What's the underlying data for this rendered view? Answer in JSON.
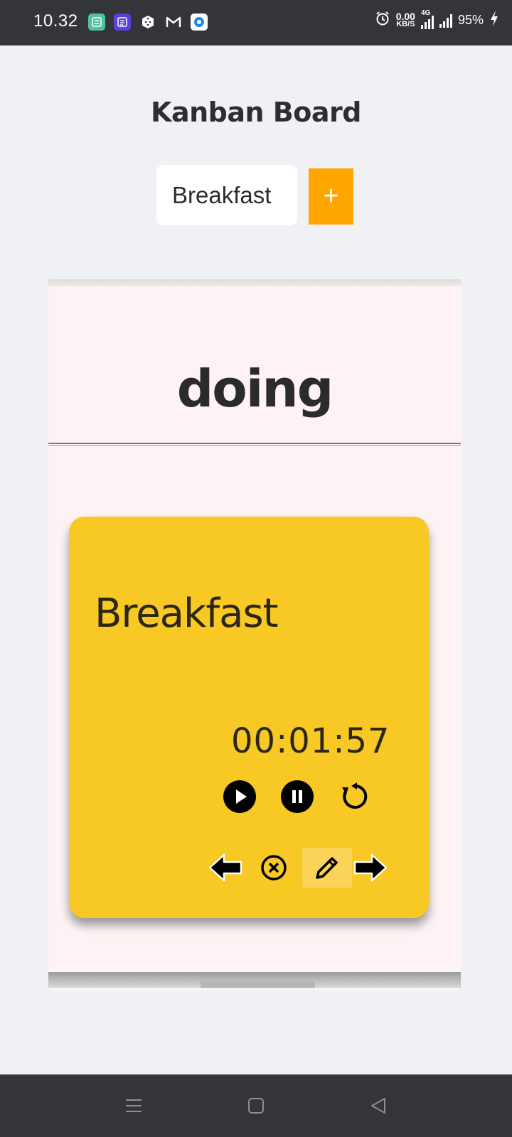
{
  "status_bar": {
    "time": "10.32",
    "net_speed_value": "0.00",
    "net_speed_unit": "KB/S",
    "network_type": "4G",
    "battery": "95%",
    "app_icons": [
      "calculator-app-icon",
      "notes-app-icon",
      "dice-app-icon",
      "gmail-icon",
      "browser-app-icon"
    ]
  },
  "header": {
    "title": "Kanban Board",
    "input_value": "Breakfast",
    "add_label": "+"
  },
  "column": {
    "title": "doing"
  },
  "card": {
    "title": "Breakfast",
    "timer": "00:01:57",
    "controls": [
      "play-icon",
      "pause-icon",
      "restart-icon"
    ],
    "actions": [
      "arrow-left-icon",
      "close-icon",
      "pencil-icon",
      "arrow-right-icon"
    ]
  },
  "colors": {
    "accent": "#ffa500",
    "card": "#f8c924",
    "column_bg": "#fdf3f4",
    "page_bg": "#f0f1f5"
  },
  "nav_bar": {
    "buttons": [
      "menu-icon",
      "home-icon",
      "back-icon"
    ]
  }
}
